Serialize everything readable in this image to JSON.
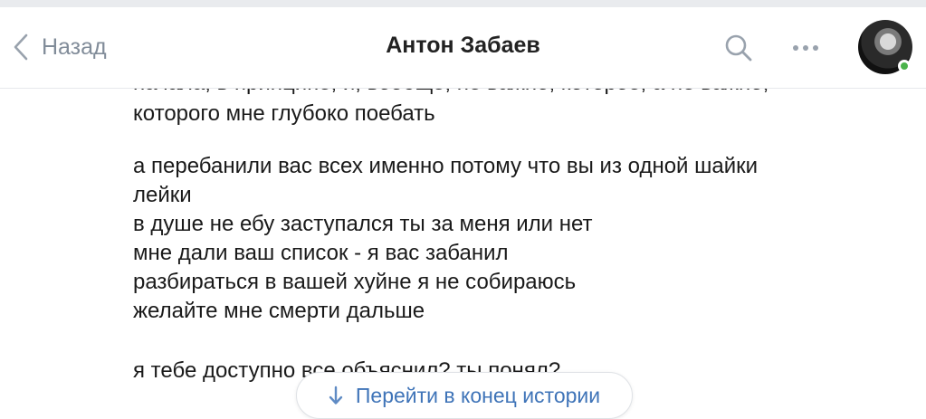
{
  "header": {
    "back_label": "Назад",
    "title": "Антон Забаев",
    "icons": {
      "back": "chevron-left-icon",
      "search": "search-icon",
      "more": "more-horizontal-icon"
    },
    "online": true
  },
  "messages": {
    "cut_top_line": "начала, в принципе, и, вообще, не важно, которое, а не важно,",
    "block1": [
      "которого мне глубоко поебать"
    ],
    "block2": [
      "а перебанили вас всех именно потому что вы из одной шайки",
      "лейки",
      "в душе не ебу заступался ты за меня или нет",
      "мне дали ваш список - я вас забанил",
      "разбираться в вашей хуйне я не собираюсь",
      "желайте мне смерти дальше"
    ],
    "block3": [
      "я тебе доступно все объяснил? ты понял?"
    ]
  },
  "scroll_button": {
    "label": "Перейти в конец истории",
    "icon": "arrow-down-icon"
  },
  "colors": {
    "accent": "#3f74b8",
    "muted": "#818c99",
    "online": "#4bb34b"
  }
}
